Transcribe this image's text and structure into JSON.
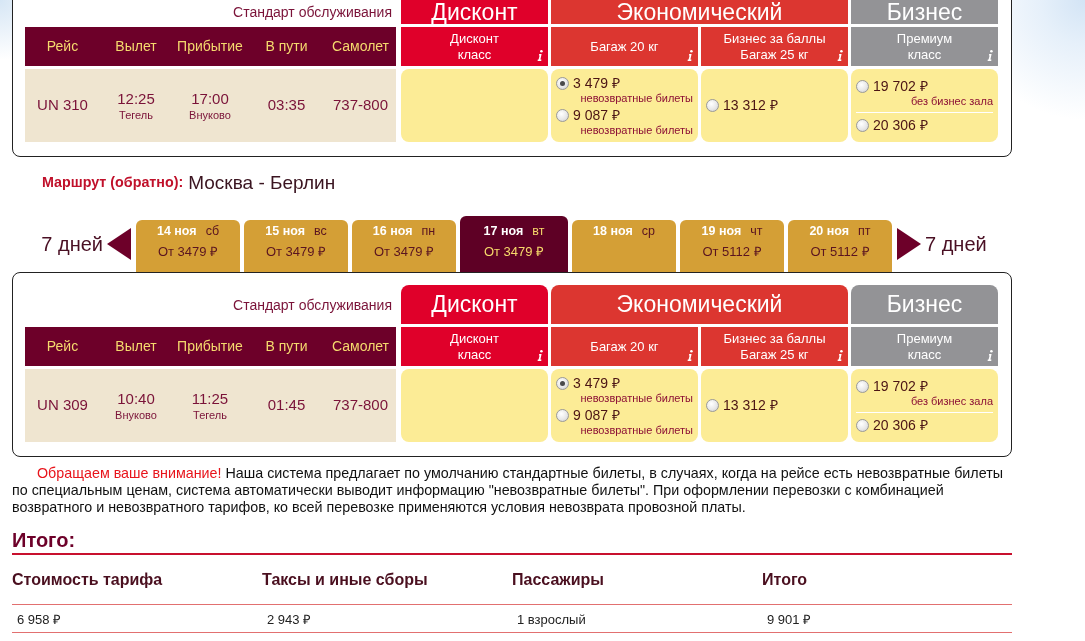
{
  "outbound_flight_table": {
    "service_label": "Стандарт обслуживания",
    "columns": [
      "Рейс",
      "Вылет",
      "Прибытие",
      "В пути",
      "Самолет"
    ],
    "flight": {
      "number": "UN 310",
      "departure_time": "12:25",
      "departure_airport": "Тегель",
      "arrival_time": "17:00",
      "arrival_airport": "Внуково",
      "duration": "03:35",
      "aircraft": "737-800"
    },
    "classes": [
      {
        "title": "Дисконт",
        "color": "#e0002a",
        "fares": [
          {
            "label": [
              "Дисконт",
              "класс"
            ]
          }
        ]
      },
      {
        "title": "Экономический",
        "color": "#dc3630",
        "fares": [
          {
            "label": [
              "Багаж 20 кг"
            ],
            "options": [
              {
                "price": "3 479 ₽",
                "note": "невозвратные билеты",
                "selected": true
              },
              {
                "price": "9 087 ₽",
                "note": "невозвратные билеты",
                "selected": false
              }
            ]
          },
          {
            "label": [
              "Бизнес за баллы",
              "Багаж 25 кг"
            ],
            "options": [
              {
                "price": "13 312 ₽",
                "selected": false
              }
            ]
          }
        ]
      },
      {
        "title": "Бизнес",
        "color": "#939396",
        "fares": [
          {
            "label": [
              "Премиум",
              "класс"
            ],
            "divided": true,
            "options": [
              {
                "price": "19 702 ₽",
                "note": "без бизнес зала",
                "selected": false
              },
              {
                "price": "20 306 ₽",
                "selected": false
              }
            ]
          }
        ]
      }
    ]
  },
  "return_route": {
    "label": "Маршрут (обратно):",
    "value": "Москва - Берлин"
  },
  "date_strip": {
    "previous_label": "7 дней",
    "days": [
      {
        "date": "14 ноя",
        "weekday": "сб",
        "price": "От 3479 ₽",
        "selected": false
      },
      {
        "date": "15 ноя",
        "weekday": "вс",
        "price": "От 3479 ₽",
        "selected": false
      },
      {
        "date": "16 ноя",
        "weekday": "пн",
        "price": "От 3479 ₽",
        "selected": false
      },
      {
        "date": "17 ноя",
        "weekday": "вт",
        "price": "От 3479 ₽",
        "selected": true
      },
      {
        "date": "18 ноя",
        "weekday": "ср",
        "selected": false
      },
      {
        "date": "19 ноя",
        "weekday": "чт",
        "price": "От 5112 ₽",
        "selected": false
      },
      {
        "date": "20 ноя",
        "weekday": "пт",
        "price": "От 5112 ₽",
        "selected": false
      }
    ],
    "next_label": "7 дней"
  },
  "return_flight_table": {
    "service_label": "Стандарт обслуживания",
    "columns": [
      "Рейс",
      "Вылет",
      "Прибытие",
      "В пути",
      "Самолет"
    ],
    "flight": {
      "number": "UN 309",
      "departure_time": "10:40",
      "departure_airport": "Внуково",
      "arrival_time": "11:25",
      "arrival_airport": "Тегель",
      "duration": "01:45",
      "aircraft": "737-800"
    },
    "classes": [
      {
        "title": "Дисконт",
        "color": "#e0002a",
        "fares": [
          {
            "label": [
              "Дисконт",
              "класс"
            ]
          }
        ]
      },
      {
        "title": "Экономический",
        "color": "#dc3630",
        "fares": [
          {
            "label": [
              "Багаж 20 кг"
            ],
            "options": [
              {
                "price": "3 479 ₽",
                "note": "невозвратные билеты",
                "selected": true
              },
              {
                "price": "9 087 ₽",
                "note": "невозвратные билеты",
                "selected": false
              }
            ]
          },
          {
            "label": [
              "Бизнес за баллы",
              "Багаж 25 кг"
            ],
            "options": [
              {
                "price": "13 312 ₽",
                "selected": false
              }
            ]
          }
        ]
      },
      {
        "title": "Бизнес",
        "color": "#939396",
        "fares": [
          {
            "label": [
              "Премиум",
              "класс"
            ],
            "divided": true,
            "options": [
              {
                "price": "19 702 ₽",
                "note": "без бизнес зала",
                "selected": false
              },
              {
                "price": "20 306 ₽",
                "selected": false
              }
            ]
          }
        ]
      }
    ]
  },
  "notice": {
    "lead": "Обращаем ваше внимание!",
    "text": "Наша система предлагает по умолчанию стандартные билеты, в случаях, когда на рейсе есть невозвратные билеты по специальным ценам, система автоматически выводит информацию \"невозвратные билеты\". При оформлении перевозки с комбинацией возвратного и невозвратного тарифов, ко всей перевозке применяются условия невозврата провозной платы."
  },
  "summary": {
    "title": "Итого:",
    "columns": [
      "Стоимость тарифа",
      "Таксы и иные сборы",
      "Пассажиры",
      "Итого"
    ],
    "rows": [
      [
        "6 958 ₽",
        "2 943 ₽",
        "1 взрослый",
        "9 901 ₽"
      ]
    ]
  }
}
